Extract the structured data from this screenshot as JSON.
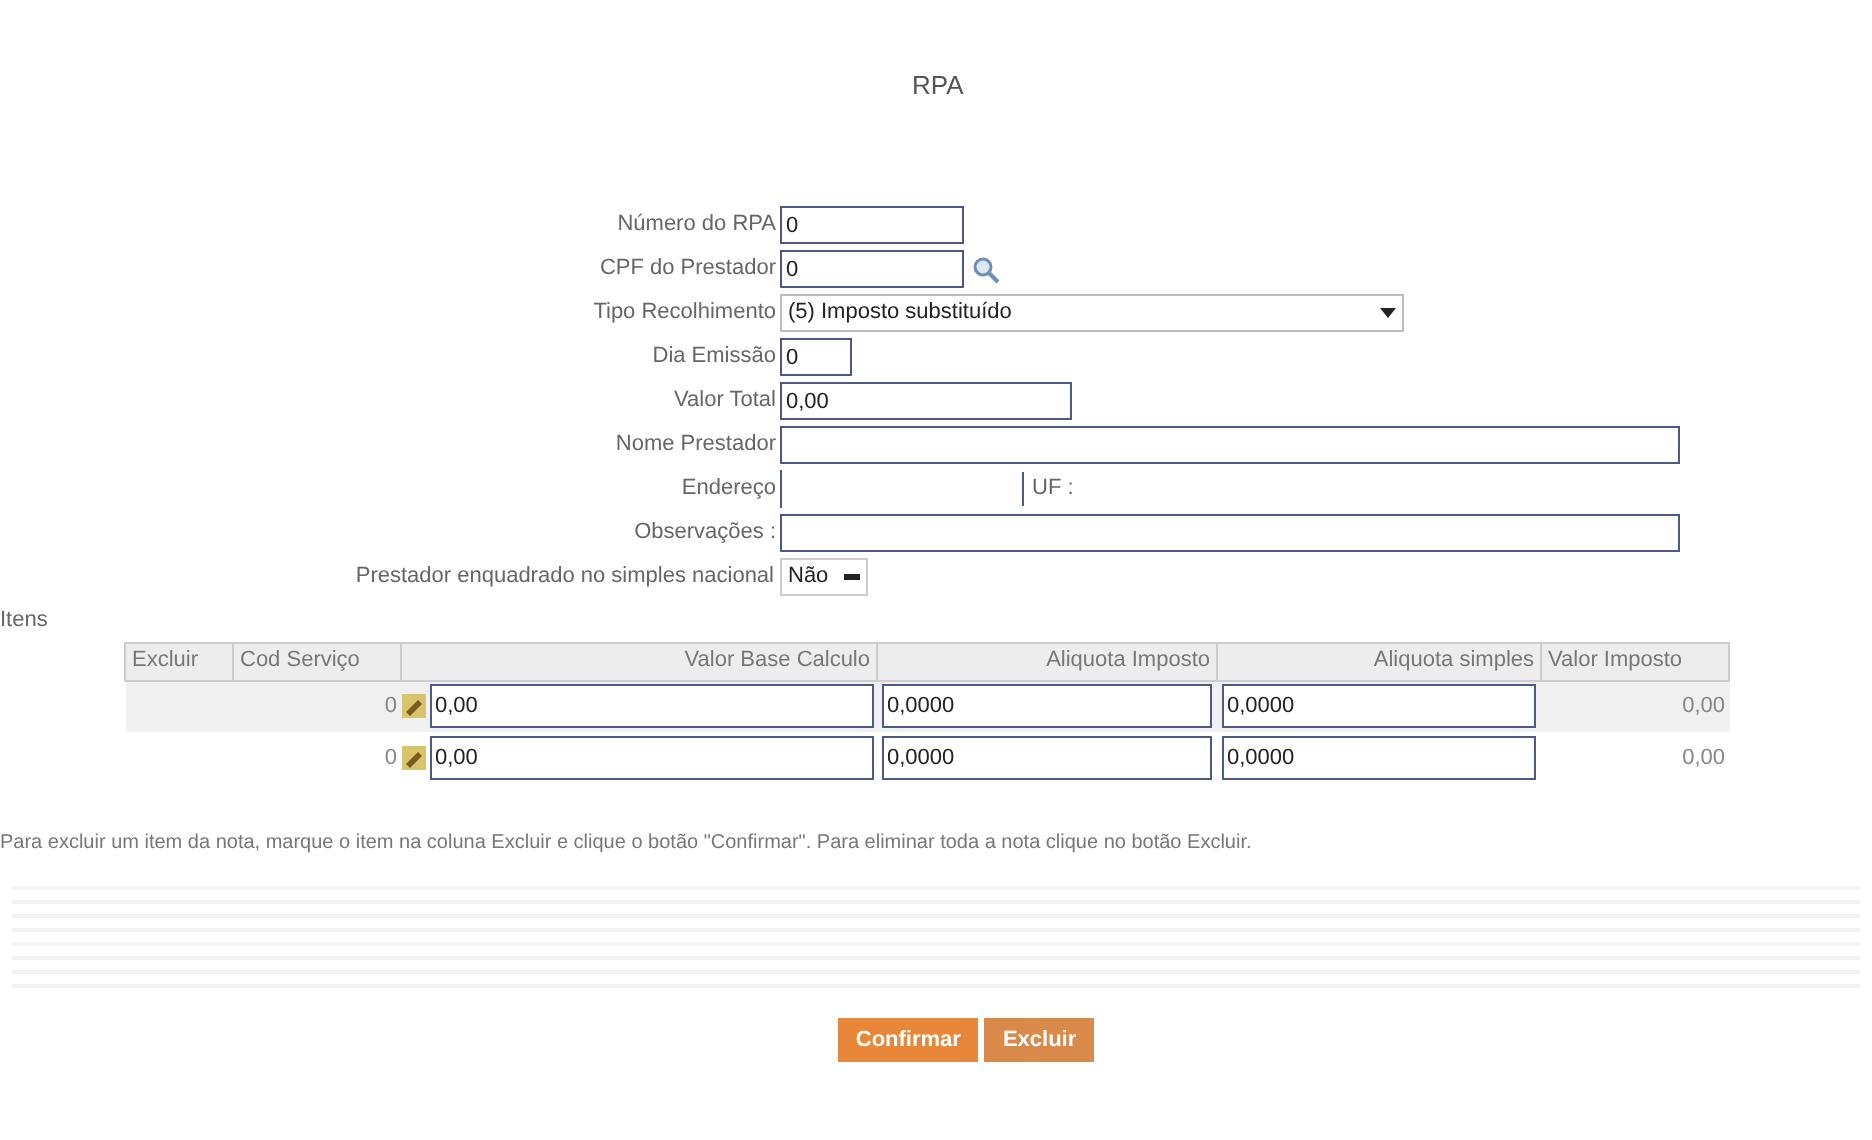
{
  "title": "RPA",
  "form": [
    {
      "label": "Número do RPA",
      "kind": "text",
      "value": "0"
    },
    {
      "label": "CPF do Prestador",
      "kind": "search",
      "value": "0"
    },
    {
      "label": "Tipo Recolhimento",
      "kind": "select",
      "value": "(5) Imposto substituído"
    },
    {
      "label": "Dia Emissão",
      "kind": "text",
      "value": "0"
    },
    {
      "label": "Valor Total",
      "kind": "text",
      "value": "0,00"
    },
    {
      "label": "Nome Prestador",
      "kind": "text"
    },
    {
      "label": "Endereço",
      "kind": "address",
      "uf_label": "UF :"
    },
    {
      "label": "Observações :",
      "kind": "text"
    }
  ],
  "simples": {
    "label": "Prestador enquadrado no simples nacional",
    "value": "Não"
  },
  "items": {
    "title": "Itens",
    "columns": [
      "Excluir",
      "Cod Serviço",
      "Valor Base Calculo",
      "Aliquota Imposto",
      "Aliquota simples",
      "Valor Imposto"
    ],
    "rows": [
      {
        "cod": "0",
        "base": "0,00",
        "aliquota": "0,0000",
        "simples": "0,0000",
        "valor": "0,00"
      },
      {
        "cod": "0",
        "base": "0,00",
        "aliquota": "0,0000",
        "simples": "0,0000",
        "valor": "0,00"
      }
    ]
  },
  "note": "Para excluir um item da nota, marque o item na coluna Excluir e clique o botão \"Confirmar\". Para eliminar toda a nota clique no botão Excluir.",
  "buttons": [
    "Confirmar",
    "Excluir"
  ]
}
